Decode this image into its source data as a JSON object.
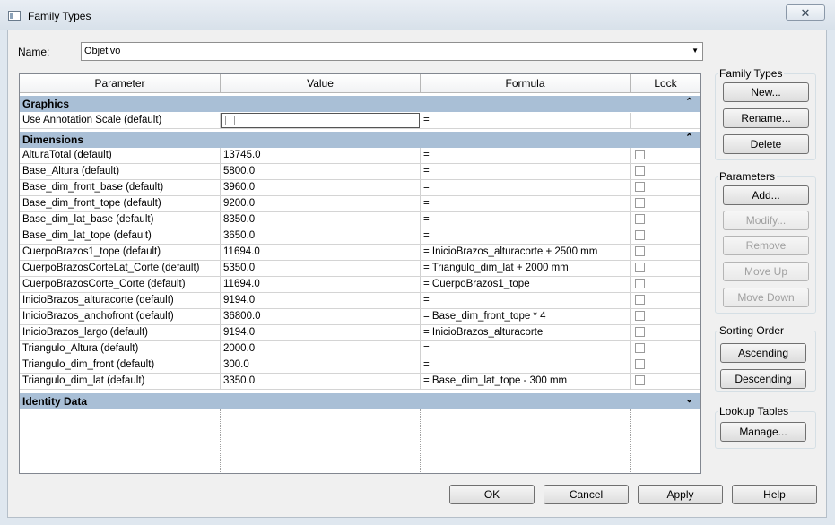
{
  "window": {
    "title": "Family Types",
    "close_glyph": "✕"
  },
  "name_field": {
    "label": "Name:",
    "value": "Objetivo"
  },
  "columns": [
    "Parameter",
    "Value",
    "Formula",
    "Lock"
  ],
  "groups": {
    "graphics": "Graphics",
    "dimensions": "Dimensions",
    "identity": "Identity Data"
  },
  "graphics_rows": [
    {
      "param": "Use Annotation Scale (default)",
      "value": "",
      "formula": "="
    }
  ],
  "dimension_rows": [
    {
      "param": "AlturaTotal (default)",
      "value": "13745.0",
      "formula": "="
    },
    {
      "param": "Base_Altura (default)",
      "value": "5800.0",
      "formula": "="
    },
    {
      "param": "Base_dim_front_base (default)",
      "value": "3960.0",
      "formula": "="
    },
    {
      "param": "Base_dim_front_tope (default)",
      "value": "9200.0",
      "formula": "="
    },
    {
      "param": "Base_dim_lat_base (default)",
      "value": "8350.0",
      "formula": "="
    },
    {
      "param": "Base_dim_lat_tope (default)",
      "value": "3650.0",
      "formula": "="
    },
    {
      "param": "CuerpoBrazos1_tope (default)",
      "value": "11694.0",
      "formula": "= InicioBrazos_alturacorte + 2500 mm"
    },
    {
      "param": "CuerpoBrazosCorteLat_Corte (default)",
      "value": "5350.0",
      "formula": "= Triangulo_dim_lat + 2000 mm"
    },
    {
      "param": "CuerpoBrazosCorte_Corte (default)",
      "value": "11694.0",
      "formula": "= CuerpoBrazos1_tope"
    },
    {
      "param": "InicioBrazos_alturacorte (default)",
      "value": "9194.0",
      "formula": "="
    },
    {
      "param": "InicioBrazos_anchofront (default)",
      "value": "36800.0",
      "formula": "= Base_dim_front_tope * 4"
    },
    {
      "param": "InicioBrazos_largo (default)",
      "value": "9194.0",
      "formula": "= InicioBrazos_alturacorte"
    },
    {
      "param": "Triangulo_Altura (default)",
      "value": "2000.0",
      "formula": "="
    },
    {
      "param": "Triangulo_dim_front (default)",
      "value": "300.0",
      "formula": "="
    },
    {
      "param": "Triangulo_dim_lat (default)",
      "value": "3350.0",
      "formula": "= Base_dim_lat_tope - 300 mm"
    }
  ],
  "family_types": {
    "title": "Family Types",
    "new": "New...",
    "rename": "Rename...",
    "delete": "Delete"
  },
  "parameters": {
    "title": "Parameters",
    "add": "Add...",
    "modify": "Modify...",
    "remove": "Remove",
    "move_up": "Move Up",
    "move_down": "Move Down"
  },
  "sorting": {
    "title": "Sorting Order",
    "ascending": "Ascending",
    "descending": "Descending"
  },
  "lookup": {
    "title": "Lookup Tables",
    "manage": "Manage..."
  },
  "footer": {
    "ok": "OK",
    "cancel": "Cancel",
    "apply": "Apply",
    "help": "Help"
  }
}
